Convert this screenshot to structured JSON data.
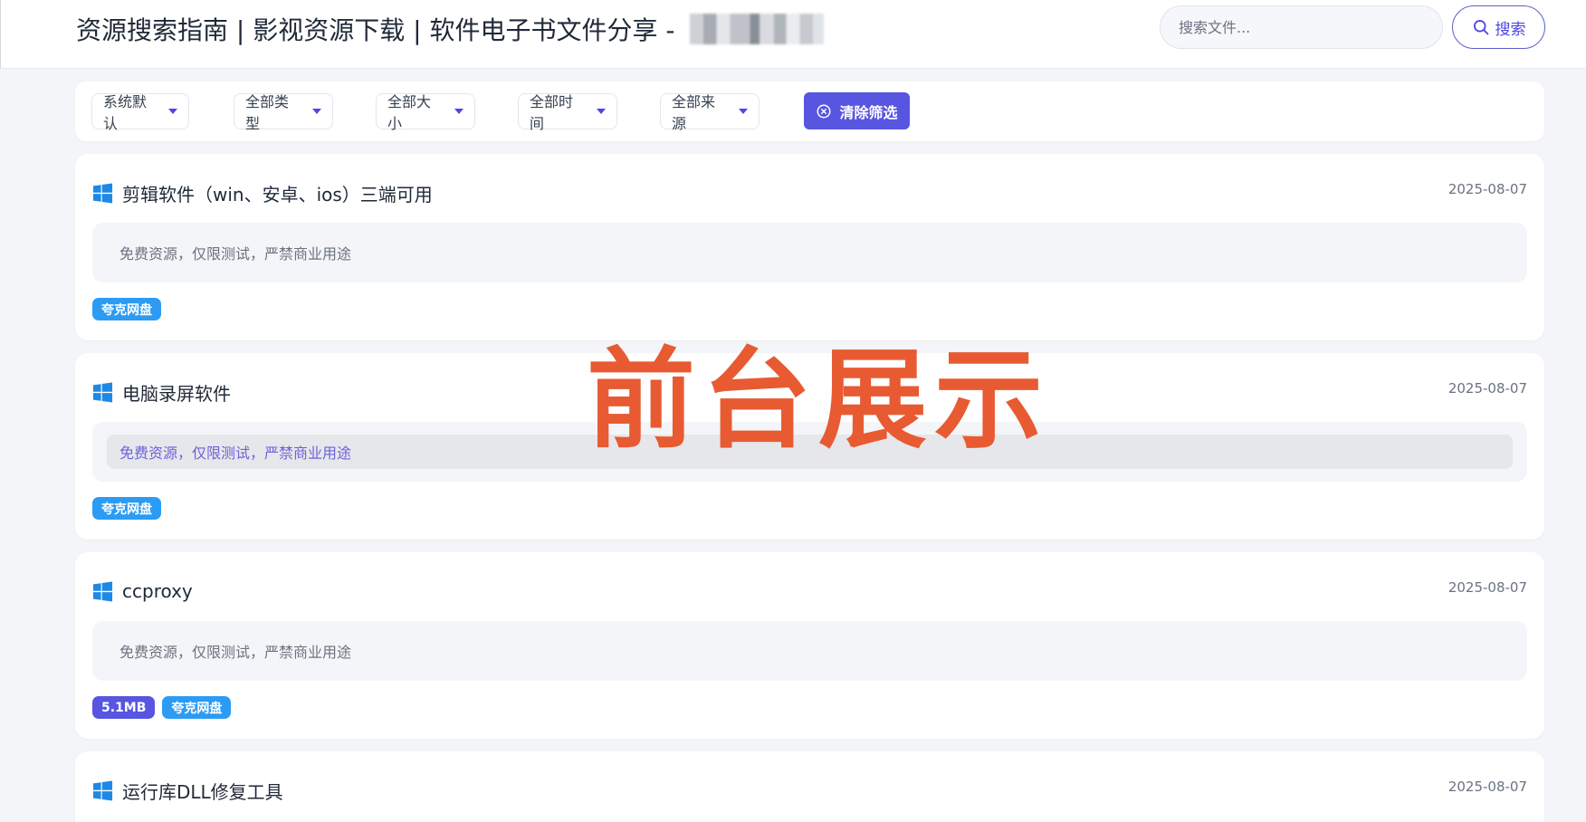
{
  "header": {
    "site_title": "资源搜索指南 | 影视资源下载 | 软件电子书文件分享 - ",
    "search_placeholder": "搜索文件...",
    "search_button_label": "搜索"
  },
  "filters": {
    "sort": "系统默认",
    "type": "全部类型",
    "size": "全部大小",
    "time": "全部时间",
    "source": "全部来源",
    "clear_label": "清除筛选"
  },
  "cards": [
    {
      "title": "剪辑软件（win、安卓、ios）三端可用",
      "date": "2025-08-07",
      "description": "免费资源，仅限测试，严禁商业用途",
      "tags": [
        "夸克网盘"
      ]
    },
    {
      "title": "电脑录屏软件",
      "date": "2025-08-07",
      "description": "免费资源，仅限测试，严禁商业用途",
      "tags": [
        "夸克网盘"
      ]
    },
    {
      "title": "ccproxy",
      "date": "2025-08-07",
      "description": "免费资源，仅限测试，严禁商业用途",
      "size_tag": "5.1MB",
      "tags": [
        "夸克网盘"
      ]
    },
    {
      "title": "运行库DLL修复工具",
      "date": "2025-08-07"
    }
  ],
  "watermark": "前台展示",
  "colors": {
    "accent": "#5855e0",
    "tag_source": "#2b9bf4",
    "watermark": "#e85a32",
    "windows_icon": "#1e88e5"
  }
}
